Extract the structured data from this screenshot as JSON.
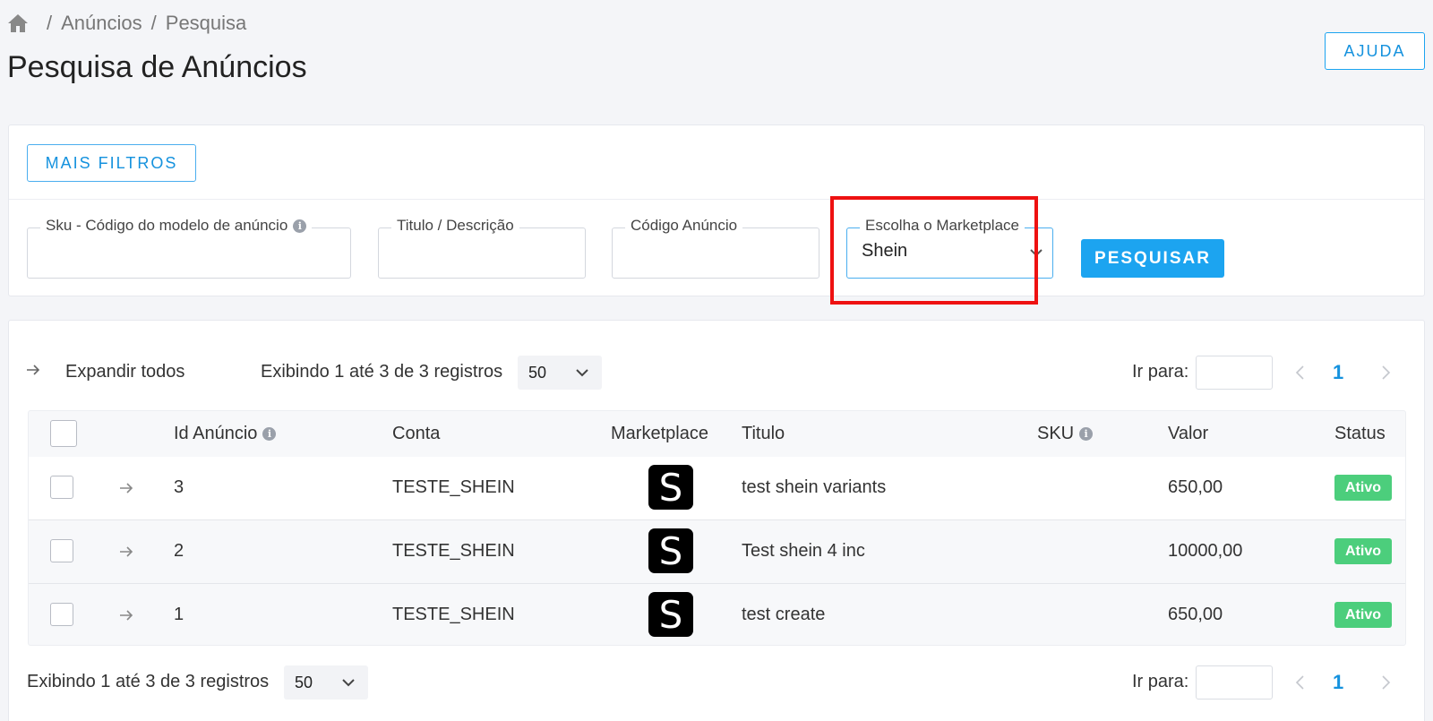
{
  "breadcrumb": {
    "sep": "/",
    "items": [
      "Anúncios",
      "Pesquisa"
    ]
  },
  "page": {
    "title": "Pesquisa de Anúncios"
  },
  "header": {
    "help_label": "AJUDA"
  },
  "filters": {
    "more_filters_label": "MAIS FILTROS",
    "sku_label": "Sku - Código do modelo de anúncio",
    "title_label": "Titulo / Descrição",
    "ad_code_label": "Código Anúncio",
    "marketplace_label": "Escolha o Marketplace",
    "marketplace_value": "Shein",
    "search_label": "PESQUISAR",
    "info_glyph": "i"
  },
  "results": {
    "expand_all": "Expandir todos",
    "showing": "Exibindo 1 até 3 de 3 registros",
    "page_size": "50",
    "goto_label": "Ir para:",
    "current_page": "1",
    "columns": {
      "id": "Id Anúncio",
      "account": "Conta",
      "marketplace": "Marketplace",
      "title": "Titulo",
      "sku": "SKU",
      "value": "Valor",
      "status": "Status"
    },
    "rows": [
      {
        "id": "3",
        "account": "TESTE_SHEIN",
        "marketplace_logo": "S",
        "title": "test shein variants",
        "sku": "",
        "value": "650,00",
        "status": "Ativo"
      },
      {
        "id": "2",
        "account": "TESTE_SHEIN",
        "marketplace_logo": "S",
        "title": "Test shein 4 inc",
        "sku": "",
        "value": "10000,00",
        "status": "Ativo"
      },
      {
        "id": "1",
        "account": "TESTE_SHEIN",
        "marketplace_logo": "S",
        "title": "test create",
        "sku": "",
        "value": "650,00",
        "status": "Ativo"
      }
    ]
  },
  "colors": {
    "accent": "#1ca4f0",
    "status_active": "#4cce7c",
    "highlight": "#ee1111"
  }
}
